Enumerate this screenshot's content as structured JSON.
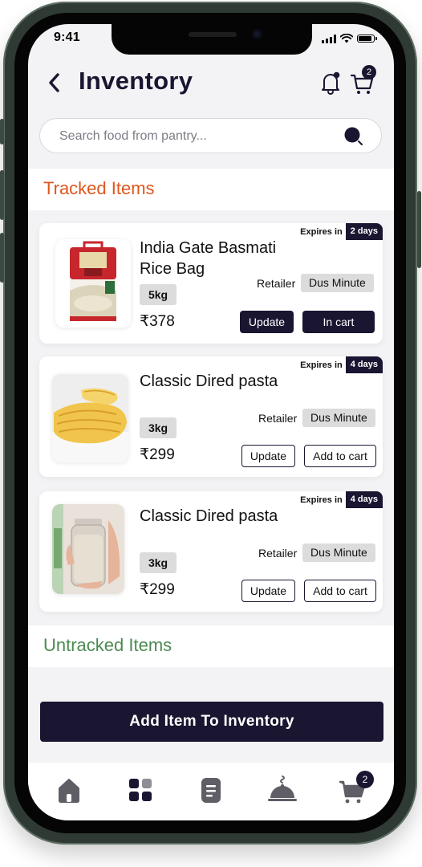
{
  "status_bar": {
    "time": "9:41"
  },
  "header": {
    "title": "Inventory",
    "notifications_icon": "bell-icon",
    "cart_icon": "cart-icon",
    "cart_count": "2"
  },
  "search": {
    "placeholder": "Search food from pantry..."
  },
  "sections": {
    "tracked": "Tracked  Items",
    "untracked": "Untracked  Items"
  },
  "items": [
    {
      "name": "India Gate Basmati Rice Bag",
      "quantity": "5kg",
      "price": "₹378",
      "expires_label": "Expires in",
      "expires_days": "2 days",
      "retailer_label": "Retailer",
      "retailer": "Dus Minute",
      "update_label": "Update",
      "cart_label": "In cart"
    },
    {
      "name": "Classic Dired pasta",
      "quantity": "3kg",
      "price": "₹299",
      "expires_label": "Expires in",
      "expires_days": "4 days",
      "retailer_label": "Retailer",
      "retailer": "Dus Minute",
      "update_label": "Update",
      "cart_label": "Add to cart"
    },
    {
      "name": "Classic Dired pasta",
      "quantity": "3kg",
      "price": "₹299",
      "expires_label": "Expires in",
      "expires_days": "4 days",
      "retailer_label": "Retailer",
      "retailer": "Dus Minute",
      "update_label": "Update",
      "cart_label": "Add to cart"
    }
  ],
  "add_button": "Add Item To Inventory",
  "bottom_nav": {
    "icons": [
      "home-icon",
      "grid-icon",
      "list-icon",
      "cloche-icon",
      "cart-icon"
    ],
    "cart_count": "2"
  },
  "colors": {
    "primary": "#1a1530",
    "tracked": "#e0551d",
    "untracked": "#4c8a52",
    "background": "#f3f3f5"
  }
}
